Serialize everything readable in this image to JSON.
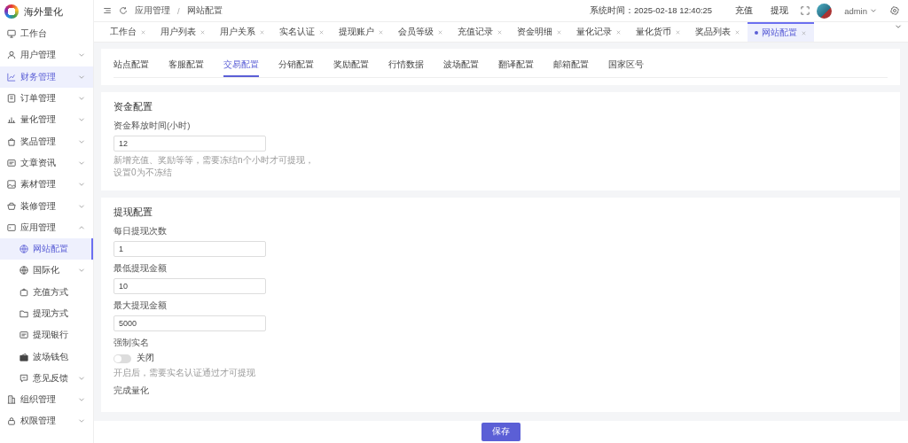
{
  "brand": {
    "name": "海外量化"
  },
  "sidebar": {
    "items": [
      {
        "label": "工作台",
        "kind": "link",
        "highlighted": false
      },
      {
        "label": "用户管理",
        "kind": "group",
        "expanded": false,
        "highlighted": false
      },
      {
        "label": "财务管理",
        "kind": "group",
        "expanded": false,
        "highlighted": true
      },
      {
        "label": "订单管理",
        "kind": "group",
        "expanded": false,
        "highlighted": false
      },
      {
        "label": "量化管理",
        "kind": "group",
        "expanded": false,
        "highlighted": false
      },
      {
        "label": "奖品管理",
        "kind": "group",
        "expanded": false,
        "highlighted": false
      },
      {
        "label": "文章资讯",
        "kind": "group",
        "expanded": false,
        "highlighted": false
      },
      {
        "label": "素材管理",
        "kind": "group",
        "expanded": false,
        "highlighted": false
      },
      {
        "label": "装修管理",
        "kind": "group",
        "expanded": false,
        "highlighted": false
      },
      {
        "label": "应用管理",
        "kind": "group",
        "expanded": true,
        "highlighted": false,
        "children": [
          {
            "label": "网站配置",
            "kind": "link",
            "selected": true
          },
          {
            "label": "国际化",
            "kind": "group",
            "expanded": false,
            "selected": false
          },
          {
            "label": "充值方式",
            "kind": "link",
            "selected": false
          },
          {
            "label": "提现方式",
            "kind": "link",
            "selected": false
          },
          {
            "label": "提现银行",
            "kind": "link",
            "selected": false
          },
          {
            "label": "波场钱包",
            "kind": "link",
            "selected": false
          },
          {
            "label": "意见反馈",
            "kind": "group",
            "expanded": false,
            "selected": false
          }
        ]
      },
      {
        "label": "组织管理",
        "kind": "group",
        "expanded": false,
        "highlighted": false
      },
      {
        "label": "权限管理",
        "kind": "group",
        "expanded": false,
        "highlighted": false
      }
    ]
  },
  "header": {
    "breadcrumb": [
      "应用管理",
      "网站配置"
    ],
    "breadcrumb_separator": "/",
    "system_time": "系统时间：2025-02-18 12:40:25",
    "links": [
      "充值",
      "提现"
    ],
    "user": "admin"
  },
  "tabs": [
    {
      "label": "工作台",
      "selected": false
    },
    {
      "label": "用户列表",
      "selected": false
    },
    {
      "label": "用户关系",
      "selected": false
    },
    {
      "label": "实名认证",
      "selected": false
    },
    {
      "label": "提现账户",
      "selected": false
    },
    {
      "label": "会员等级",
      "selected": false
    },
    {
      "label": "充值记录",
      "selected": false
    },
    {
      "label": "资金明细",
      "selected": false
    },
    {
      "label": "量化记录",
      "selected": false
    },
    {
      "label": "量化货币",
      "selected": false
    },
    {
      "label": "奖品列表",
      "selected": false
    },
    {
      "label": "网站配置",
      "selected": true
    }
  ],
  "sub_tabs": [
    {
      "label": "站点配置",
      "selected": false
    },
    {
      "label": "客服配置",
      "selected": false
    },
    {
      "label": "交易配置",
      "selected": true
    },
    {
      "label": "分销配置",
      "selected": false
    },
    {
      "label": "奖励配置",
      "selected": false
    },
    {
      "label": "行情数据",
      "selected": false
    },
    {
      "label": "波场配置",
      "selected": false
    },
    {
      "label": "翻译配置",
      "selected": false
    },
    {
      "label": "邮箱配置",
      "selected": false
    },
    {
      "label": "国家区号",
      "selected": false
    }
  ],
  "sections": [
    {
      "title": "资金配置",
      "fields": [
        {
          "kind": "input",
          "label": "资金释放时间(小时)",
          "value": "12",
          "help": "新增充值、奖励等等，需要冻结n个小时才可提现，设置0为不冻结"
        }
      ]
    },
    {
      "title": "提现配置",
      "fields": [
        {
          "kind": "input",
          "label": "每日提现次数",
          "value": "1"
        },
        {
          "kind": "input",
          "label": "最低提现金额",
          "value": "10"
        },
        {
          "kind": "input",
          "label": "最大提现金额",
          "value": "5000"
        },
        {
          "kind": "switch",
          "label": "强制实名",
          "on": false,
          "state_text": "关闭",
          "help": "开启后，需要实名认证通过才可提现"
        },
        {
          "kind": "label",
          "label": "完成量化"
        }
      ]
    }
  ],
  "footer": {
    "save": "保存"
  }
}
